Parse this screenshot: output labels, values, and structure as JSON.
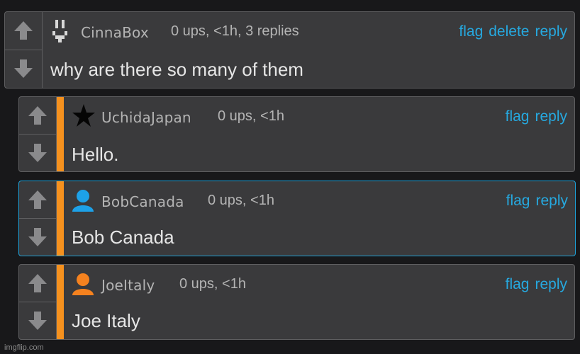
{
  "comments": [
    {
      "username": "CinnaBox",
      "meta": "0 ups, <1h, 3 replies",
      "actions": [
        "flag",
        "delete",
        "reply"
      ],
      "text": "why are there so many of them",
      "avatar": "pixel-face-icon"
    },
    {
      "username": "UchidaJapan",
      "meta": "0 ups, <1h",
      "actions": [
        "flag",
        "reply"
      ],
      "text": "Hello.",
      "avatar": "black-star-icon"
    },
    {
      "username": "BobCanada",
      "meta": "0 ups, <1h",
      "actions": [
        "flag",
        "reply"
      ],
      "text": "Bob Canada",
      "avatar": "blue-user-icon",
      "avatar_color": "#1da1e8"
    },
    {
      "username": "JoeItaly",
      "meta": "0 ups, <1h",
      "actions": [
        "flag",
        "reply"
      ],
      "text": "Joe Italy",
      "avatar": "orange-user-icon",
      "avatar_color": "#f5821f"
    }
  ],
  "colors": {
    "link": "#26a9e0",
    "accent": "#f5911e",
    "highlight_border": "#1da1d8"
  },
  "watermark": "imgflip.com"
}
